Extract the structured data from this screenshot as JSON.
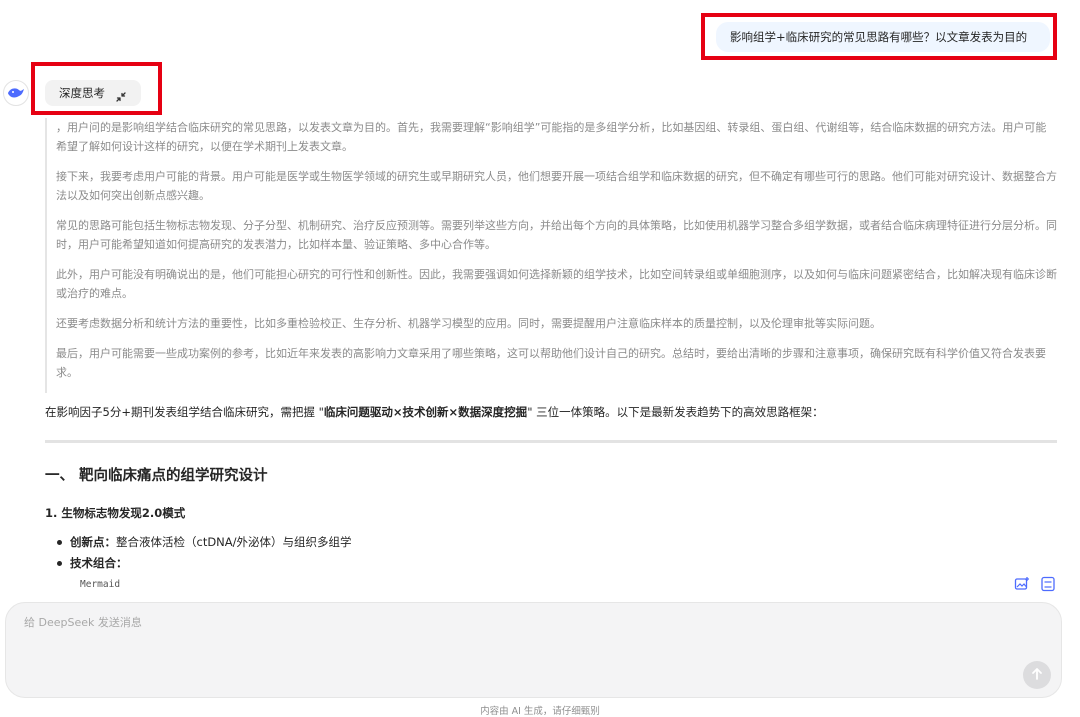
{
  "user_message": "影响组学+临床研究的常见思路有哪些？以文章发表为目的",
  "annotation_color": "#e60012",
  "thinking_toggle": {
    "label": "深度思考",
    "icon": "collapse-arrows-icon"
  },
  "thinking_paragraphs": [
    "，用户问的是影响组学结合临床研究的常见思路，以发表文章为目的。首先，我需要理解“影响组学”可能指的是多组学分析，比如基因组、转录组、蛋白组、代谢组等，结合临床数据的研究方法。用户可能希望了解如何设计这样的研究，以便在学术期刊上发表文章。",
    "接下来，我要考虑用户可能的背景。用户可能是医学或生物医学领域的研究生或早期研究人员，他们想要开展一项结合组学和临床数据的研究，但不确定有哪些可行的思路。他们可能对研究设计、数据整合方法以及如何突出创新点感兴趣。",
    "常见的思路可能包括生物标志物发现、分子分型、机制研究、治疗反应预测等。需要列举这些方向，并给出每个方向的具体策略，比如使用机器学习整合多组学数据，或者结合临床病理特征进行分层分析。同时，用户可能希望知道如何提高研究的发表潜力，比如样本量、验证策略、多中心合作等。",
    "此外，用户可能没有明确说出的是，他们可能担心研究的可行性和创新性。因此，我需要强调如何选择新颖的组学技术，比如空间转录组或单细胞测序，以及如何与临床问题紧密结合，比如解决现有临床诊断或治疗的难点。",
    "还要考虑数据分析和统计方法的重要性，比如多重检验校正、生存分析、机器学习模型的应用。同时，需要提醒用户注意临床样本的质量控制，以及伦理审批等实际问题。",
    "最后，用户可能需要一些成功案例的参考，比如近年来发表的高影响力文章采用了哪些策略，这可以帮助他们设计自己的研究。总结时，要给出清晰的步骤和注意事项，确保研究既有科学价值又符合发表要求。"
  ],
  "answer": {
    "intro_pre": "在影响因子5分+期刊发表组学结合临床研究，需把握 \"",
    "intro_bold": "临床问题驱动×技术创新×数据深度挖掘",
    "intro_post": "\" 三位一体策略。以下是最新发表趋势下的高效思路框架：",
    "section_title": "一、 靶向临床痛点的组学研究设计",
    "subsection_title": "1. 生物标志物发现2.0模式",
    "bullets": [
      {
        "label": "创新点：",
        "text": "整合液体活检（ctDNA/外泌体）与组织多组学"
      },
      {
        "label": "技术组合：",
        "text": ""
      }
    ],
    "code_lang": "Mermaid",
    "code_actions": [
      "add-image-icon",
      "svg-icon"
    ]
  },
  "composer": {
    "placeholder": "给 DeepSeek 发送消息"
  },
  "footer_note": "内容由 AI 生成，请仔细甄别"
}
